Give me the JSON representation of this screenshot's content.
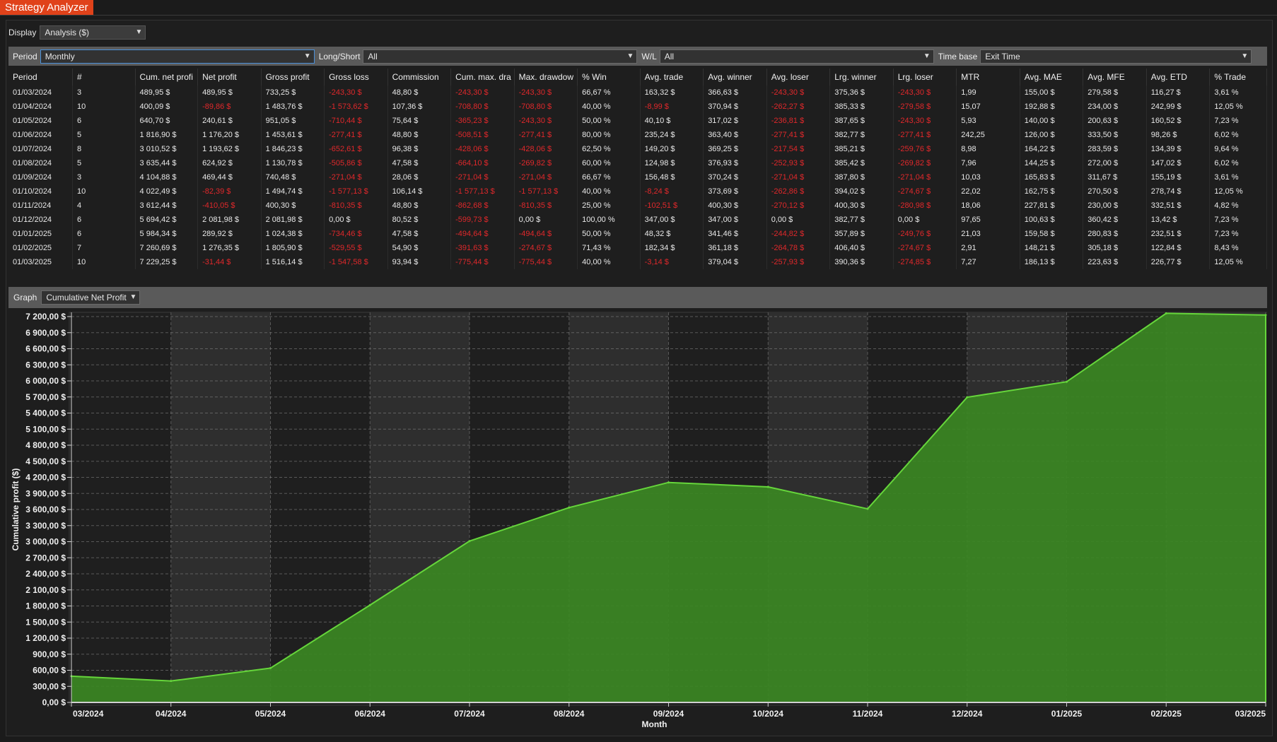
{
  "title_tab": "Strategy Analyzer",
  "display": {
    "label": "Display",
    "value": "Analysis ($)"
  },
  "filters": {
    "period": {
      "label": "Period",
      "value": "Monthly"
    },
    "long_short": {
      "label": "Long/Short",
      "value": "All"
    },
    "wl": {
      "label": "W/L",
      "value": "All"
    },
    "time_base": {
      "label": "Time base",
      "value": "Exit Time"
    }
  },
  "table": {
    "columns": [
      "Period",
      "#",
      "Cum. net profi",
      "Net profit",
      "Gross profit",
      "Gross loss",
      "Commission",
      "Cum. max. dra",
      "Max. drawdow",
      "% Win",
      "Avg. trade",
      "Avg. winner",
      "Avg. loser",
      "Lrg. winner",
      "Lrg. loser",
      "MTR",
      "Avg. MAE",
      "Avg. MFE",
      "Avg. ETD",
      "% Trade"
    ],
    "rows": [
      [
        "01/03/2024",
        "3",
        "489,95 $",
        "489,95 $",
        "733,25 $",
        "-243,30 $",
        "48,80 $",
        "-243,30 $",
        "-243,30 $",
        "66,67 %",
        "163,32 $",
        "366,63 $",
        "-243,30 $",
        "375,36 $",
        "-243,30 $",
        "1,99",
        "155,00 $",
        "279,58 $",
        "116,27 $",
        "3,61 %"
      ],
      [
        "01/04/2024",
        "10",
        "400,09 $",
        "-89,86 $",
        "1 483,76 $",
        "-1 573,62 $",
        "107,36 $",
        "-708,80 $",
        "-708,80 $",
        "40,00 %",
        "-8,99 $",
        "370,94 $",
        "-262,27 $",
        "385,33 $",
        "-279,58 $",
        "15,07",
        "192,88 $",
        "234,00 $",
        "242,99 $",
        "12,05 %"
      ],
      [
        "01/05/2024",
        "6",
        "640,70 $",
        "240,61 $",
        "951,05 $",
        "-710,44 $",
        "75,64 $",
        "-365,23 $",
        "-243,30 $",
        "50,00 %",
        "40,10 $",
        "317,02 $",
        "-236,81 $",
        "387,65 $",
        "-243,30 $",
        "5,93",
        "140,00 $",
        "200,63 $",
        "160,52 $",
        "7,23 %"
      ],
      [
        "01/06/2024",
        "5",
        "1 816,90 $",
        "1 176,20 $",
        "1 453,61 $",
        "-277,41 $",
        "48,80 $",
        "-508,51 $",
        "-277,41 $",
        "80,00 %",
        "235,24 $",
        "363,40 $",
        "-277,41 $",
        "382,77 $",
        "-277,41 $",
        "242,25",
        "126,00 $",
        "333,50 $",
        "98,26 $",
        "6,02 %"
      ],
      [
        "01/07/2024",
        "8",
        "3 010,52 $",
        "1 193,62 $",
        "1 846,23 $",
        "-652,61 $",
        "96,38 $",
        "-428,06 $",
        "-428,06 $",
        "62,50 %",
        "149,20 $",
        "369,25 $",
        "-217,54 $",
        "385,21 $",
        "-259,76 $",
        "8,98",
        "164,22 $",
        "283,59 $",
        "134,39 $",
        "9,64 %"
      ],
      [
        "01/08/2024",
        "5",
        "3 635,44 $",
        "624,92 $",
        "1 130,78 $",
        "-505,86 $",
        "47,58 $",
        "-664,10 $",
        "-269,82 $",
        "60,00 %",
        "124,98 $",
        "376,93 $",
        "-252,93 $",
        "385,42 $",
        "-269,82 $",
        "7,96",
        "144,25 $",
        "272,00 $",
        "147,02 $",
        "6,02 %"
      ],
      [
        "01/09/2024",
        "3",
        "4 104,88 $",
        "469,44 $",
        "740,48 $",
        "-271,04 $",
        "28,06 $",
        "-271,04 $",
        "-271,04 $",
        "66,67 %",
        "156,48 $",
        "370,24 $",
        "-271,04 $",
        "387,80 $",
        "-271,04 $",
        "10,03",
        "165,83 $",
        "311,67 $",
        "155,19 $",
        "3,61 %"
      ],
      [
        "01/10/2024",
        "10",
        "4 022,49 $",
        "-82,39 $",
        "1 494,74 $",
        "-1 577,13 $",
        "106,14 $",
        "-1 577,13 $",
        "-1 577,13 $",
        "40,00 %",
        "-8,24 $",
        "373,69 $",
        "-262,86 $",
        "394,02 $",
        "-274,67 $",
        "22,02",
        "162,75 $",
        "270,50 $",
        "278,74 $",
        "12,05 %"
      ],
      [
        "01/11/2024",
        "4",
        "3 612,44 $",
        "-410,05 $",
        "400,30 $",
        "-810,35 $",
        "48,80 $",
        "-862,68 $",
        "-810,35 $",
        "25,00 %",
        "-102,51 $",
        "400,30 $",
        "-270,12 $",
        "400,30 $",
        "-280,98 $",
        "18,06",
        "227,81 $",
        "230,00 $",
        "332,51 $",
        "4,82 %"
      ],
      [
        "01/12/2024",
        "6",
        "5 694,42 $",
        "2 081,98 $",
        "2 081,98 $",
        "0,00 $",
        "80,52 $",
        "-599,73 $",
        "0,00 $",
        "100,00 %",
        "347,00 $",
        "347,00 $",
        "0,00 $",
        "382,77 $",
        "0,00 $",
        "97,65",
        "100,63 $",
        "360,42 $",
        "13,42 $",
        "7,23 %"
      ],
      [
        "01/01/2025",
        "6",
        "5 984,34 $",
        "289,92 $",
        "1 024,38 $",
        "-734,46 $",
        "47,58 $",
        "-494,64 $",
        "-494,64 $",
        "50,00 %",
        "48,32 $",
        "341,46 $",
        "-244,82 $",
        "357,89 $",
        "-249,76 $",
        "21,03",
        "159,58 $",
        "280,83 $",
        "232,51 $",
        "7,23 %"
      ],
      [
        "01/02/2025",
        "7",
        "7 260,69 $",
        "1 276,35 $",
        "1 805,90 $",
        "-529,55 $",
        "54,90 $",
        "-391,63 $",
        "-274,67 $",
        "71,43 %",
        "182,34 $",
        "361,18 $",
        "-264,78 $",
        "406,40 $",
        "-274,67 $",
        "2,91",
        "148,21 $",
        "305,18 $",
        "122,84 $",
        "8,43 %"
      ],
      [
        "01/03/2025",
        "10",
        "7 229,25 $",
        "-31,44 $",
        "1 516,14 $",
        "-1 547,58 $",
        "93,94 $",
        "-775,44 $",
        "-775,44 $",
        "40,00 %",
        "-3,14 $",
        "379,04 $",
        "-257,93 $",
        "390,36 $",
        "-274,85 $",
        "7,27",
        "186,13 $",
        "223,63 $",
        "226,77 $",
        "12,05 %"
      ]
    ]
  },
  "graph": {
    "label": "Graph",
    "value": "Cumulative Net Profit"
  },
  "colors": {
    "accent": "#e0421a",
    "negative": "#e0282b",
    "area_fill": "#3d8a24",
    "area_line": "#63d33a"
  },
  "chart_data": {
    "type": "area",
    "x": [
      "03/2024",
      "04/2024",
      "05/2024",
      "06/2024",
      "07/2024",
      "08/2024",
      "09/2024",
      "10/2024",
      "11/2024",
      "12/2024",
      "01/2025",
      "02/2025",
      "03/2025"
    ],
    "values": [
      489.95,
      400.09,
      640.7,
      1816.9,
      3010.52,
      3635.44,
      4104.88,
      4022.49,
      3612.44,
      5694.42,
      5984.34,
      7260.69,
      7229.25
    ],
    "y_ticks": [
      "0,00 $",
      "300,00 $",
      "600,00 $",
      "900,00 $",
      "1 200,00 $",
      "1 500,00 $",
      "1 800,00 $",
      "2 100,00 $",
      "2 400,00 $",
      "2 700,00 $",
      "3 000,00 $",
      "3 300,00 $",
      "3 600,00 $",
      "3 900,00 $",
      "4 200,00 $",
      "4 500,00 $",
      "4 800,00 $",
      "5 100,00 $",
      "5 400,00 $",
      "5 700,00 $",
      "6 000,00 $",
      "6 300,00 $",
      "6 600,00 $",
      "6 900,00 $",
      "7 200,00 $"
    ],
    "ylim": [
      0,
      7200
    ],
    "xlabel": "Month",
    "ylabel": "Cumulative profit ($)",
    "grid": true
  }
}
